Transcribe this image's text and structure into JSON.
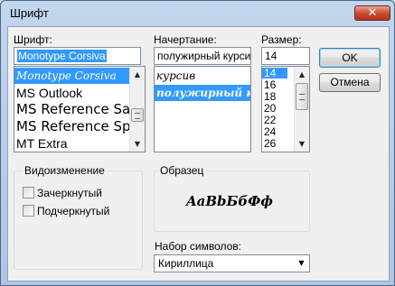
{
  "window": {
    "title": "Шрифт",
    "close_glyph": "✕"
  },
  "font": {
    "label": "Шрифт:",
    "value": "Monotype Corsiva",
    "items": [
      {
        "label": "Monotype Corsiva",
        "selected": true
      },
      {
        "label": "MS Outlook"
      },
      {
        "label": "MS Reference San"
      },
      {
        "label": "MS Reference Speci"
      },
      {
        "label": "MT Extra"
      }
    ]
  },
  "style": {
    "label": "Начертание:",
    "value": "полужирный курсив",
    "items": [
      {
        "label": "курсив"
      },
      {
        "label": "полужирный к",
        "selected": true
      }
    ]
  },
  "size": {
    "label": "Размер:",
    "value": "14",
    "items": [
      {
        "label": "14",
        "selected": true
      },
      {
        "label": "16"
      },
      {
        "label": "18"
      },
      {
        "label": "20"
      },
      {
        "label": "22"
      },
      {
        "label": "24"
      },
      {
        "label": "26"
      }
    ]
  },
  "buttons": {
    "ok": "OK",
    "cancel": "Отмена"
  },
  "effects": {
    "label": "Видоизменение",
    "strikeout": {
      "label": "Зачеркнутый",
      "checked": false
    },
    "underline": {
      "label": "Подчеркнутый",
      "checked": false
    }
  },
  "sample": {
    "label": "Образец",
    "text": "AaBbБбФф"
  },
  "charset": {
    "label": "Набор символов:",
    "value": "Кириллица"
  },
  "icons": {
    "scroll_up": "▲",
    "scroll_down": "▼",
    "dropdown": "▼"
  }
}
